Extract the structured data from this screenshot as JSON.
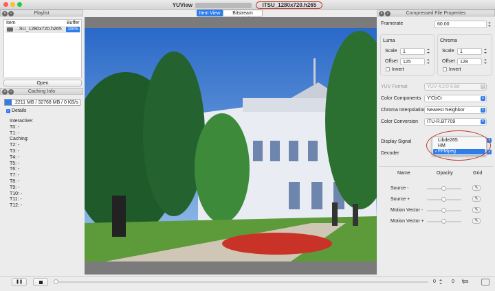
{
  "window": {
    "title": "YUView",
    "file_name": "ITSU_1280x720.h265"
  },
  "tabs": [
    {
      "label": "Item View"
    },
    {
      "label": "Bitstream Analysis"
    }
  ],
  "playlist": {
    "title": "Playlist",
    "col_item": "Item",
    "col_buffer": "Buffer",
    "item_name": "...SU_1280x720.h265",
    "buffer_value": "100%",
    "open_button": "Open"
  },
  "caching": {
    "title": "Caching Info",
    "usage": "2211 MB / 32768 MB / 0 KB/s",
    "details_label": "Details",
    "lines": [
      "Interactive:",
      "T0: -",
      "T1: -",
      "Caching:",
      "T2: -",
      "T3: -",
      "T4: -",
      "T5: -",
      "T6: -",
      "T7: -",
      "T8: -",
      "T9: -",
      "T10: -",
      "T11: -",
      "T12: -"
    ]
  },
  "properties": {
    "title": "Compressed File Properties",
    "framerate_label": "Framerate",
    "framerate_value": "60.00",
    "luma": {
      "title": "Luma",
      "scale_label": "Scale",
      "scale_value": "1",
      "offset_label": "Offset",
      "offset_value": "125",
      "invert_label": "Invert"
    },
    "chroma": {
      "title": "Chroma",
      "scale_label": "Scale",
      "scale_value": "1",
      "offset_label": "Offset",
      "offset_value": "128",
      "invert_label": "Invert"
    },
    "yuv_format_label": "YUV Format",
    "yuv_format_value": "YUV 4:2:0 8-bit",
    "color_components_label": "Color Components",
    "color_components_value": "Y'CbCr",
    "chroma_interp_label": "Chroma Interpolation",
    "chroma_interp_value": "Nearest Neighbor",
    "color_conversion_label": "Color Conversion",
    "color_conversion_value": "ITU-R.BT709",
    "display_signal_label": "Display Signal",
    "decoder_label": "Decoder",
    "decoder_options": [
      {
        "label": "Libde265"
      },
      {
        "label": "HM"
      },
      {
        "label": "FFMpeg"
      }
    ],
    "decoder_selected": "✓",
    "overlay_cols": {
      "name": "Name",
      "opacity": "Opacity",
      "grid": "Grid"
    },
    "overlays": [
      {
        "name": "Source -"
      },
      {
        "name": "Source +"
      },
      {
        "name": "Motion Vector -"
      },
      {
        "name": "Motion Vector +"
      }
    ]
  },
  "playback": {
    "frame_value": "0",
    "fps_value": "0",
    "fps_label": "fps"
  },
  "colors": {
    "accent": "#2f7de9",
    "annotation": "#c0392b"
  }
}
